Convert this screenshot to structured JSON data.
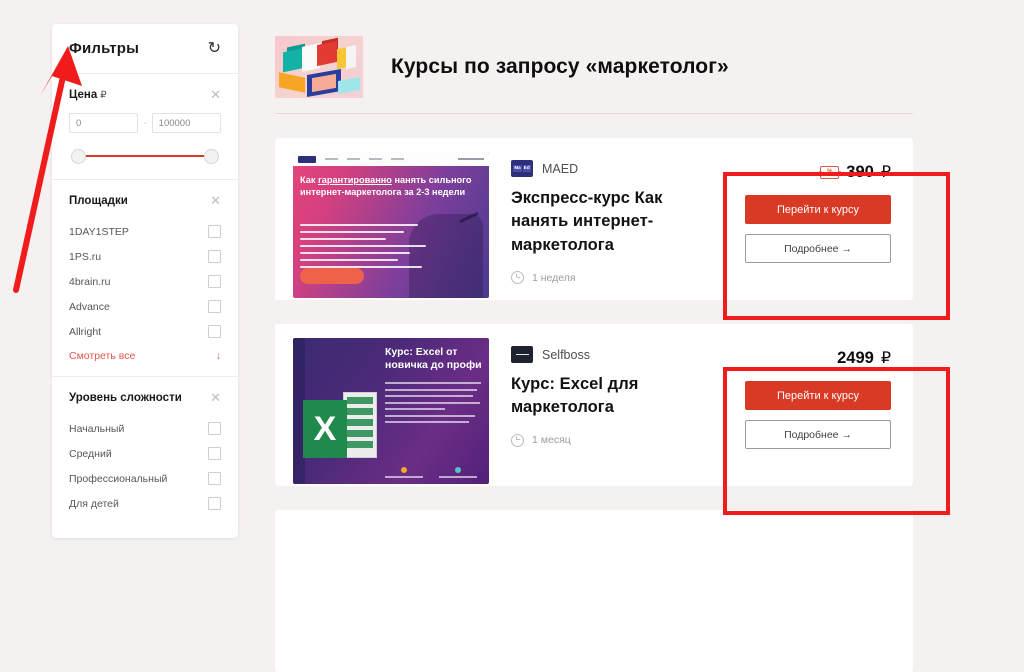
{
  "theme": {
    "page_background": "#f6f1f1",
    "accent_red": "#d93a26",
    "annotation_red": "#f01c1c",
    "link_red": "#e2574c"
  },
  "sidebar": {
    "title": "Фильтры",
    "refresh_icon": "refresh-icon",
    "sections": [
      {
        "title": "Цена",
        "currency": "₽",
        "close_icon": "close-icon",
        "price_min": "0",
        "price_max": "100000",
        "dash": "-"
      },
      {
        "title": "Площадки",
        "close_icon": "close-icon",
        "items": [
          {
            "label": "1DAY1STEP"
          },
          {
            "label": "1PS.ru"
          },
          {
            "label": "4brain.ru"
          },
          {
            "label": "Advance"
          },
          {
            "label": "Allright"
          }
        ],
        "show_all_label": "Смотреть все",
        "show_all_arrow": "↓"
      },
      {
        "title": "Уровень сложности",
        "close_icon": "close-icon",
        "items": [
          {
            "label": "Начальный"
          },
          {
            "label": "Средний"
          },
          {
            "label": "Профессиональный"
          },
          {
            "label": "Для детей"
          }
        ]
      }
    ]
  },
  "header": {
    "thumb_icon": "colored-cubes-image",
    "title": "Курсы по запросу «маркетолог»"
  },
  "cards": [
    {
      "thumb": {
        "icon": "maed-landing-thumbnail",
        "headline_part1": "Как ",
        "headline_underlined": "гарантированно",
        "headline_part2": " нанять сильного интернет-маркетолога за 2-3 недели"
      },
      "provider": {
        "logo_icon": "maed-logo",
        "logo_text_1": "Ma",
        "logo_text_2": "Ed",
        "name": "MAED"
      },
      "title": "Экспресс-курс Как нанять интернет-маркетолога",
      "duration_icon": "clock-icon",
      "duration": "1 неделя",
      "price_icon": "coupon-ticket-icon",
      "price": "390",
      "currency": "₽",
      "primary_button": "Перейти к курсу",
      "secondary_button": "Подробнее →",
      "has_coupon": true
    },
    {
      "thumb": {
        "icon": "excel-course-thumbnail",
        "headline": "Курс: Excel от новичка до профи",
        "logo_letter": "X"
      },
      "provider": {
        "logo_icon": "selfboss-logo",
        "name": "Selfboss"
      },
      "title": "Курс: Excel для маркетолога",
      "duration_icon": "clock-icon",
      "duration": "1 месяц",
      "price": "2499",
      "currency": "₽",
      "primary_button": "Перейти к курсу",
      "secondary_button": "Подробнее →",
      "has_coupon": false
    }
  ],
  "annotations": {
    "arrow_icon": "red-arrow-pointing-to-filters",
    "highlight_icon": "red-highlight-box"
  }
}
